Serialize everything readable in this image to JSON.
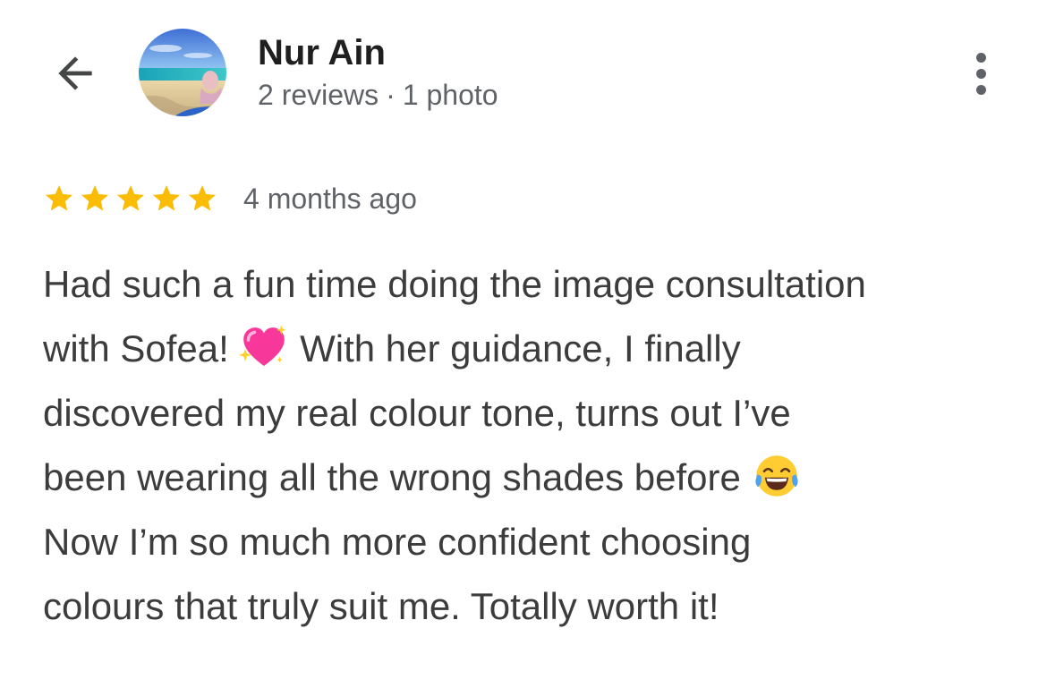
{
  "header": {
    "back_icon": "arrow-back-icon",
    "avatar_icon": "beach-photo-avatar",
    "reviewer_name": "Nur Ain",
    "reviews_count": "2 reviews",
    "separator": "·",
    "photos_count": "1 photo",
    "more_icon": "more-vert-icon"
  },
  "review": {
    "rating": 5,
    "rating_max": 5,
    "star_color": "#fbbc04",
    "time_ago": "4 months ago",
    "lines": [
      {
        "before": "Had such a fun time doing the image consultation"
      },
      {
        "before": "with Sofea!",
        "emoji": "💖",
        "emoji_icon": "sparkling-heart-icon",
        "after": "With her guidance, I finally"
      },
      {
        "before": "discovered my real colour tone, turns out I’ve"
      },
      {
        "before": "been wearing all the wrong shades before",
        "emoji": "😂",
        "emoji_icon": "tears-of-joy-icon"
      },
      {
        "before": "Now I’m so much more confident choosing"
      },
      {
        "before": "colours that truly suit me. Totally worth it!"
      }
    ]
  }
}
